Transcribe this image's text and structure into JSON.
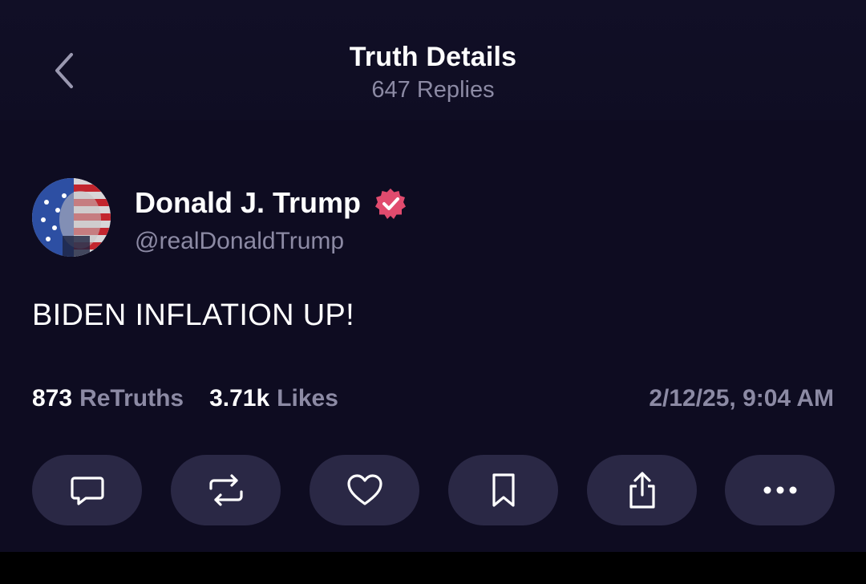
{
  "header": {
    "title": "Truth Details",
    "subtitle": "647 Replies"
  },
  "post": {
    "author_name": "Donald J. Trump",
    "author_handle": "@realDonaldTrump",
    "text": "BIDEN INFLATION UP!",
    "verified_color": "#e14b6e"
  },
  "stats": {
    "retruths_count": "873",
    "retruths_label": "ReTruths",
    "likes_count": "3.71k",
    "likes_label": "Likes",
    "timestamp": "2/12/25, 9:04 AM"
  },
  "actions": [
    {
      "icon": "reply-icon"
    },
    {
      "icon": "retruth-icon"
    },
    {
      "icon": "like-icon"
    },
    {
      "icon": "bookmark-icon"
    },
    {
      "icon": "share-icon"
    },
    {
      "icon": "more-icon"
    }
  ],
  "colors": {
    "background": "#0e0c21",
    "button_background": "#2a2845",
    "text_primary": "#ffffff",
    "text_secondary": "#8c8aa4"
  }
}
